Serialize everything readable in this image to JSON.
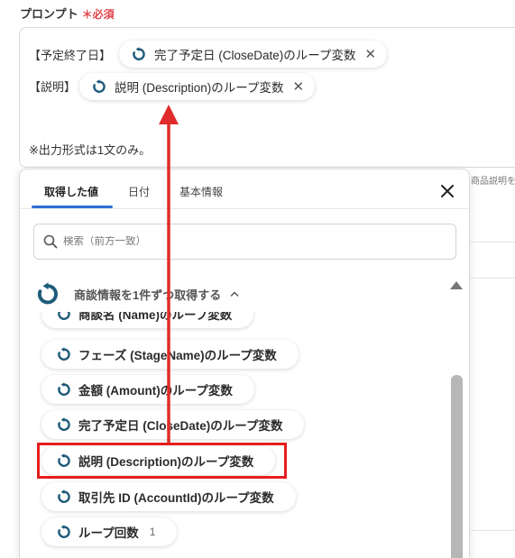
{
  "field": {
    "label": "プロンプト",
    "required_mark": "＊必須"
  },
  "prompt": {
    "line1_prefix": "【予定終了日】",
    "line1_chip": "完了予定日 (CloseDate)のループ変数",
    "line2_prefix": "【説明】",
    "line2_chip": "説明 (Description)のループ変数",
    "note": "※出力形式は1文のみ。"
  },
  "side_text": "商品説明を",
  "popup": {
    "tabs": [
      "取得した値",
      "日付",
      "基本情報"
    ],
    "active_tab": "取得した値",
    "search_placeholder": "検索（前方一致）",
    "group_title": "商談情報を1件ずつ取得する",
    "items": [
      {
        "label": "商談名 (Name)のループ変数"
      },
      {
        "label": "フェーズ (StageName)のループ変数"
      },
      {
        "label": "金額 (Amount)のループ変数"
      },
      {
        "label": "完了予定日 (CloseDate)のループ変数"
      },
      {
        "label": "説明 (Description)のループ変数"
      },
      {
        "label": "取引先 ID (AccountId)のループ変数"
      },
      {
        "label": "ループ回数",
        "count": "1"
      }
    ]
  },
  "colors": {
    "accent_icon": "#1e5a7a",
    "highlight": "#e51e1e",
    "arrow": "#e02b2b",
    "tab_underline": "#2e6fd6",
    "required": "#e0464b"
  },
  "icons": [
    "loop-icon",
    "close-icon",
    "search-icon",
    "chevron-up-icon",
    "scroll-up-icon"
  ]
}
